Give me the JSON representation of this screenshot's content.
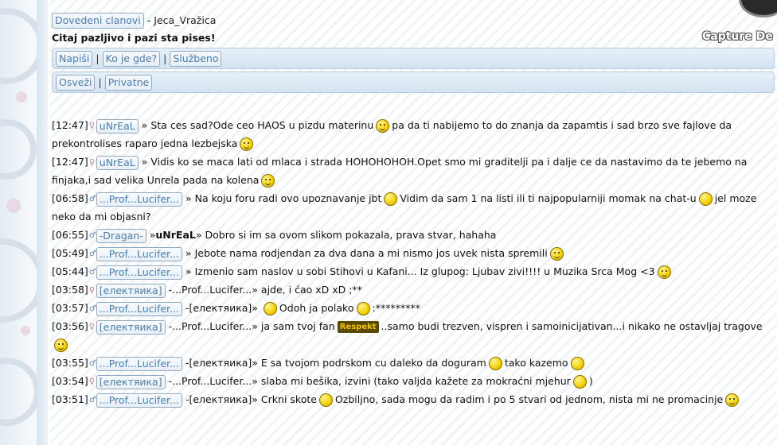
{
  "header": {
    "online_link": "Dovedeni clanovi",
    "separator": "-",
    "nickname": "Jeca_Vražica",
    "notice": "Citaj pazljivo i pazi sta pises!",
    "watermark": "Capture De"
  },
  "nav1": {
    "items": [
      "Napiši",
      "Ko je gde?",
      "Službeno"
    ],
    "sep": "|"
  },
  "nav2": {
    "items": [
      "Osveži",
      "Privatne"
    ],
    "sep": "|"
  },
  "messages": [
    {
      "time": "[12:47]",
      "user": "uNrEaL",
      "arrow": "»",
      "to": "",
      "text": [
        "Sta ces sad?Ode ceo HAOS u pizdu materinu",
        "pa da ti nabijemo to do znanja da zapamtis i sad brzo sve fajlove da prekontrolises raparo jedna lezbejska",
        ""
      ]
    },
    {
      "time": "[12:47]",
      "user": "uNrEaL",
      "arrow": "»",
      "to": "",
      "text": [
        "Vidis ko se maca lati od mlaca i strada HOHOHOHOH.Opet smo mi graditelji pa i dalje ce da nastavimo da te jebemo na finjaka,i sad velika Unrela pada na kolena",
        ""
      ]
    },
    {
      "time": "[06:58]",
      "user": "...Prof...Lucifer...",
      "arrow": "»",
      "to": "",
      "text": [
        "Na koju foru radi ovo upoznavanje jbt",
        "Vidim da sam 1 na listi ili ti najpopularniji momak na chat-u",
        "jel moze neko da mi objasni?"
      ]
    },
    {
      "time": "[06:55]",
      "user": "-Dragan-",
      "arrow": "»",
      "to": "uNrEaL",
      "arrow2": "»",
      "text": [
        "Dobro si im sa ovom slikom pokazala, prava stvar, hahaha"
      ]
    },
    {
      "time": "[05:49]",
      "user": "...Prof...Lucifer...",
      "arrow": "»",
      "to": "",
      "text": [
        "Jebote nama rodjendan za dva dana a mi nismo jos uvek nista spremili",
        ""
      ]
    },
    {
      "time": "[05:44]",
      "user": "...Prof...Lucifer...",
      "arrow": "»",
      "to": "",
      "text": [
        "Izmenio sam naslov u sobi Stihovi u Kafani... Iz glupog: Ljubav zivi!!!! u Muzika Srca Mog <3",
        ""
      ]
    },
    {
      "time": "[03:58]",
      "user": "[електяика]",
      "arrow": "-",
      "to": "...Prof...Lucifer...",
      "arrow2": "»",
      "text": [
        "ajde, i ćao xD xD ;**"
      ]
    },
    {
      "time": "[03:57]",
      "user": "...Prof...Lucifer...",
      "arrow": "-",
      "to": "[електяика]",
      "arrow2": "»",
      "text": [
        "",
        "Odoh ja polako",
        ":*********"
      ]
    },
    {
      "time": "[03:56]",
      "user": "[електяика]",
      "arrow": "-",
      "to": "...Prof...Lucifer...",
      "arrow2": "»",
      "text": [
        "ja sam tvoj fan",
        "..samo budi trezven, vispren i samoinicijativan...i nikako ne ostavljaj tragove",
        ""
      ]
    },
    {
      "time": "[03:55]",
      "user": "...Prof...Lucifer...",
      "arrow": "-",
      "to": "[електяика]",
      "arrow2": "»",
      "text": [
        "E sa tvojom podrskom cu daleko da doguram",
        "tako kazemo",
        ""
      ]
    },
    {
      "time": "[03:54]",
      "user": "[електяика]",
      "arrow": "-",
      "to": "...Prof...Lucifer...",
      "arrow2": "»",
      "text": [
        "slaba mi bešika, izvini (tako valjda kažete za mokraćni mjehur",
        ")"
      ]
    },
    {
      "time": "[03:51]",
      "user": "...Prof...Lucifer...",
      "arrow": "-",
      "to": "[електяика]",
      "arrow2": "»",
      "text": [
        "Crkni skote",
        "Ozbiljno, sada mogu da radim i po 5 stvari od jednom, nista mi ne promacinje",
        ""
      ]
    }
  ],
  "respekt_label": "Respekt",
  "colors": {
    "link": "#4a7db0",
    "nav_bg": "#d4e3f1",
    "smiley": "#f5d000"
  }
}
